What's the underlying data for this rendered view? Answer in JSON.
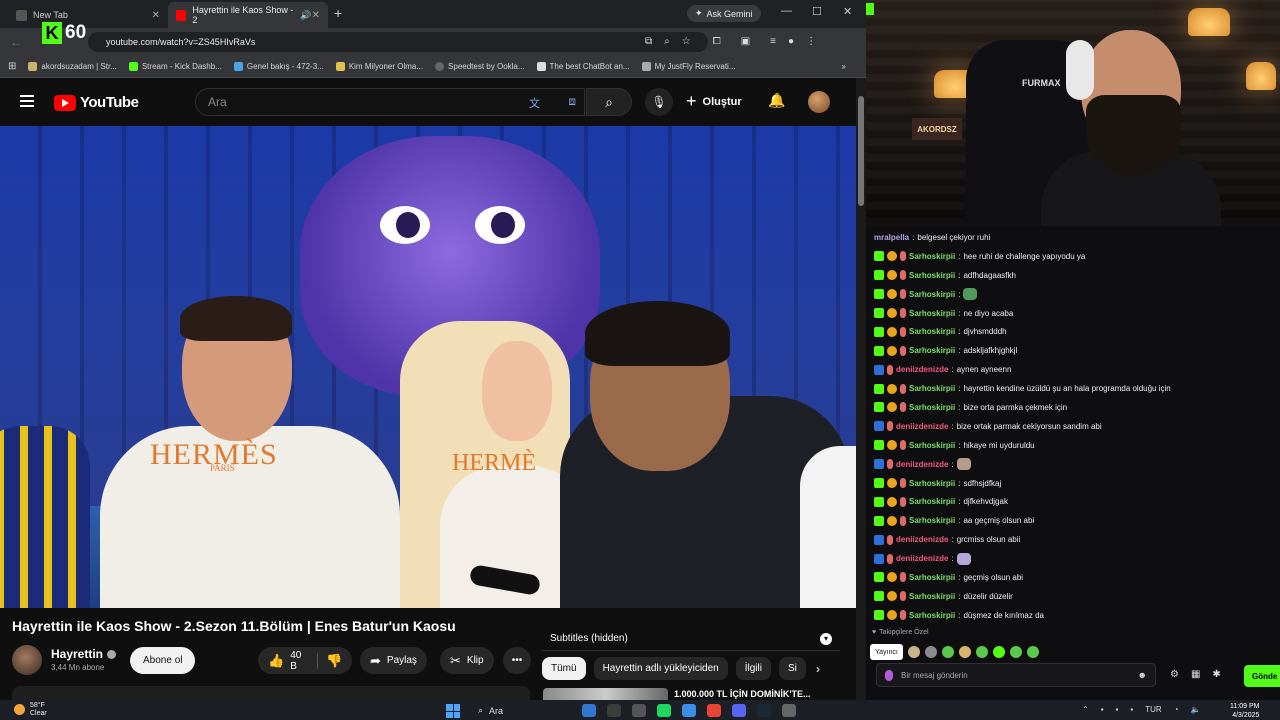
{
  "browser": {
    "tabs": [
      {
        "label": "New Tab",
        "active": false
      },
      {
        "label": "Hayrettin ile Kaos Show - 2",
        "active": true
      }
    ],
    "gemini_label": "Ask Gemini",
    "url": "youtube.com/watch?v=ZS45HIvRaVs",
    "kick_badge": {
      "letter": "K",
      "count": "60"
    },
    "bookmarks": [
      "akordsuzadam | Str...",
      "Stream - Kick Dashb...",
      "Genel bakış - 472-3...",
      "Kim Milyoner Olma...",
      "Speedtest by Ookla...",
      "The best ChatBot an...",
      "My JustFly Reservati..."
    ]
  },
  "youtube": {
    "logo_text": "YouTube",
    "search_placeholder": "Ara",
    "create_label": "Oluştur",
    "video": {
      "hermes_text": "HERMÈS",
      "paris_text": "PARIS",
      "hermes_text_2": "HERMÈ",
      "title": "Hayrettin ile Kaos Show - 2.Sezon 11.Bölüm | Enes Batur'un Kaosu"
    },
    "channel": {
      "name": "Hayrettin",
      "subscribers": "3,44 Mn abone",
      "subscribe_label": "Abone ol"
    },
    "actions": {
      "likes": "40 B",
      "share": "Paylaş",
      "clip": "Klip",
      "more": "•••"
    },
    "subtitles_header": "Subtitles (hidden)",
    "chips": [
      "Tümü",
      "Hayrettin adlı yükleyiciden",
      "İlgili",
      "Si"
    ],
    "recommendation_title": "1.000.000 TL İÇİN DOMİNİK'TE..."
  },
  "stream": {
    "cam_chair_text": "FURMAX",
    "cam_sign_text": "AKORDSZ",
    "chat": [
      {
        "user": "mralpella",
        "text": "belgesel çekiyor ruhi",
        "color": "#b4a3e8",
        "badges": []
      },
      {
        "user": "Sarhoskirpii",
        "text": "hee ruhi de challenge yapıyodu ya",
        "color": "#7fdc6a",
        "badges": [
          "kick",
          "gift",
          "pin"
        ]
      },
      {
        "user": "Sarhoskirpii",
        "text": "adfhdagaasfkh",
        "color": "#7fdc6a",
        "badges": [
          "kick",
          "gift",
          "pin"
        ]
      },
      {
        "user": "Sarhoskirpii",
        "text": "",
        "emote": "#4f9a5a",
        "color": "#7fdc6a",
        "badges": [
          "kick",
          "gift",
          "pin"
        ]
      },
      {
        "user": "Sarhoskirpii",
        "text": "ne diyo acaba",
        "color": "#7fdc6a",
        "badges": [
          "kick",
          "gift",
          "pin"
        ]
      },
      {
        "user": "Sarhoskirpii",
        "text": "djvhsmdddh",
        "color": "#7fdc6a",
        "badges": [
          "kick",
          "gift",
          "pin"
        ]
      },
      {
        "user": "Sarhoskirpii",
        "text": "adskljafkhjghkjl",
        "color": "#7fdc6a",
        "badges": [
          "kick",
          "gift",
          "pin"
        ]
      },
      {
        "user": "deniizdenizde",
        "text": "aynen ayneenn",
        "color": "#f35b80",
        "badges": [
          "sub",
          "pin"
        ]
      },
      {
        "user": "Sarhoskirpii",
        "text": "hayrettin kendine üzüldü şu an hala programda olduğu için",
        "color": "#7fdc6a",
        "badges": [
          "kick",
          "gift",
          "pin"
        ]
      },
      {
        "user": "Sarhoskirpii",
        "text": "bize orta parmka çekmek için",
        "color": "#7fdc6a",
        "badges": [
          "kick",
          "gift",
          "pin"
        ]
      },
      {
        "user": "deniizdenizde",
        "text": "bize ortak parmak cekiyorsun sandim abi",
        "color": "#f35b80",
        "badges": [
          "sub",
          "pin"
        ]
      },
      {
        "user": "Sarhoskirpii",
        "text": "hikaye mi uyduruldu",
        "color": "#7fdc6a",
        "badges": [
          "kick",
          "gift",
          "pin"
        ]
      },
      {
        "user": "deniizdenizde",
        "text": "",
        "emote": "#b89c8a",
        "color": "#f35b80",
        "badges": [
          "sub",
          "pin"
        ]
      },
      {
        "user": "Sarhoskirpii",
        "text": "sdfhsjdfkaj",
        "color": "#7fdc6a",
        "badges": [
          "kick",
          "gift",
          "pin"
        ]
      },
      {
        "user": "Sarhoskirpii",
        "text": "djfkehvdjgak",
        "color": "#7fdc6a",
        "badges": [
          "kick",
          "gift",
          "pin"
        ]
      },
      {
        "user": "Sarhoskirpii",
        "text": "aa geçmiş olsun abi",
        "color": "#7fdc6a",
        "badges": [
          "kick",
          "gift",
          "pin"
        ]
      },
      {
        "user": "deniizdenizde",
        "text": "grcmiss olsun abii",
        "color": "#f35b80",
        "badges": [
          "sub",
          "pin"
        ]
      },
      {
        "user": "deniizdenizde",
        "text": "",
        "emote": "#b7a7d8",
        "color": "#f35b80",
        "badges": [
          "sub",
          "pin"
        ]
      },
      {
        "user": "Sarhoskirpii",
        "text": "geçmiş olsun abi",
        "color": "#7fdc6a",
        "badges": [
          "kick",
          "gift",
          "pin"
        ]
      },
      {
        "user": "Sarhoskirpii",
        "text": "düzelir düzelir",
        "color": "#7fdc6a",
        "badges": [
          "kick",
          "gift",
          "pin"
        ]
      },
      {
        "user": "Sarhoskirpii",
        "text": "düşmez de kırılmaz da",
        "color": "#7fdc6a",
        "badges": [
          "kick",
          "gift",
          "pin"
        ]
      }
    ],
    "followers_only": "Takipçilere Özel",
    "yayinci_label": "Yayıncı",
    "emote_colors": [
      "#c8b48a",
      "#8a8a8a",
      "#59c94d",
      "#d8b46a",
      "#59c94d",
      "#53fc18",
      "#59c94d",
      "#59c94d"
    ],
    "chat_placeholder": "Bir mesaj gönderin",
    "send_label": "Gönde"
  },
  "taskbar": {
    "temperature": "58°F",
    "condition": "Clear",
    "search_label": "Ara",
    "language": "TUR",
    "time": "11:09 PM",
    "date": "4/3/2025",
    "app_colors": [
      "#2f78d0",
      "#3d3d3d",
      "#555",
      "#1ed760",
      "#3a8ee6",
      "#e94335",
      "#5865f2",
      "#1b2838",
      "#666"
    ]
  }
}
